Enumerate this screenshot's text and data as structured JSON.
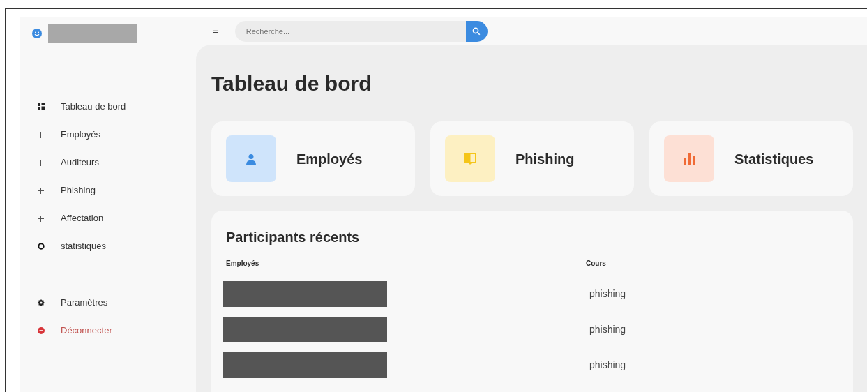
{
  "header": {
    "search": {
      "placeholder": "Recherche..."
    },
    "menu_glyph": "≡"
  },
  "sidebar": {
    "items": [
      {
        "label": "Tableau de bord",
        "kind": "grid",
        "danger": false
      },
      {
        "label": "Employés",
        "kind": "plus",
        "danger": false
      },
      {
        "label": "Auditeurs",
        "kind": "plus",
        "danger": false
      },
      {
        "label": "Phishing",
        "kind": "plus",
        "danger": false
      },
      {
        "label": "Affectation",
        "kind": "plus",
        "danger": false
      },
      {
        "label": "statistiques",
        "kind": "ring",
        "danger": false
      }
    ],
    "bottom_items": [
      {
        "label": "Paramètres",
        "kind": "gear",
        "danger": false
      },
      {
        "label": "Déconnecter",
        "kind": "logout",
        "danger": true
      }
    ]
  },
  "page": {
    "title": "Tableau de bord",
    "cards": [
      {
        "label": "Employés",
        "kind": "person",
        "color": "#cfe4fb"
      },
      {
        "label": "Phishing",
        "kind": "book",
        "color": "#fdf0c2"
      },
      {
        "label": "Statistiques",
        "kind": "chart",
        "color": "#fde0d5"
      }
    ],
    "recent": {
      "title": "Participants récents",
      "columns": [
        "Employés",
        "Cours"
      ],
      "rows": [
        {
          "course": "phishing"
        },
        {
          "course": "phishing"
        },
        {
          "course": "phishing"
        }
      ]
    }
  }
}
